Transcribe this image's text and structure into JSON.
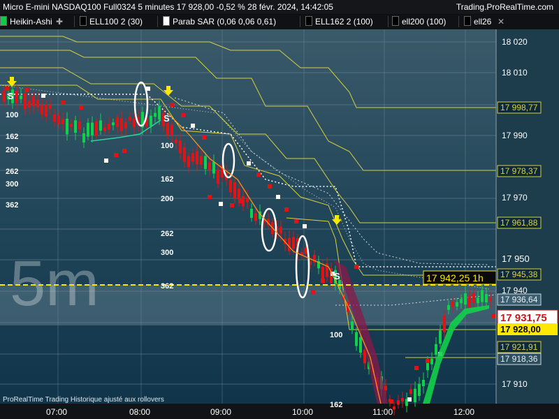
{
  "window": {
    "title": "Micro E-mini NASDAQ100 Full0324 5 minutes 17 928,00 -0,52 % 28 févr. 2024, 14:42:05",
    "brand": "Trading.ProRealTime.com"
  },
  "toolbar": {
    "items": [
      {
        "label": "Heikin-Ashi",
        "swatch": "#12c94a",
        "extra": "✚"
      },
      {
        "label": "ELL100 2 (30)",
        "swatch": "#000000"
      },
      {
        "label": "Parab SAR (0,06 0,06 0,61)",
        "swatch": "#ffffff"
      },
      {
        "label": "ELL162 2 (100)",
        "swatch": "#000000"
      },
      {
        "label": "ell200 (100)",
        "swatch": "#000000"
      },
      {
        "label": "ell26",
        "swatch": "#000000"
      }
    ],
    "close_label": "✕"
  },
  "colors": {
    "up": "#12d04a",
    "down": "#e01414",
    "sar": "#ffffff",
    "level": "#d8d040",
    "price_line": "#ffe800",
    "last_price": "#c81818",
    "grid": "#6f8797"
  },
  "watermark": "5m",
  "footer": "ProRealTime Trading  Historique ajusté aux rollovers",
  "price_axis": {
    "ticks": [
      "18 020",
      "18 010",
      "17 990",
      "17 970",
      "17 950",
      "17 940",
      "17 910"
    ],
    "tags": [
      "17 998,77",
      "17 978,37",
      "17 961,88",
      "17 945,38",
      "17 936,64",
      "17 921,91",
      "17 918,36"
    ],
    "last_price": "17 931,75",
    "current": "17 928,00"
  },
  "cursor_label": "17 942,25 1h",
  "time_axis": [
    "07:00",
    "08:00",
    "09:00",
    "10:00",
    "11:00",
    "12:00"
  ],
  "chart_labels": [
    {
      "text": "100"
    },
    {
      "text": "162"
    },
    {
      "text": "200"
    },
    {
      "text": "262"
    },
    {
      "text": "300"
    },
    {
      "text": "362"
    },
    {
      "text": "100"
    },
    {
      "text": "162"
    },
    {
      "text": "200"
    },
    {
      "text": "262"
    },
    {
      "text": "300"
    },
    {
      "text": "362"
    },
    {
      "text": "100"
    },
    {
      "text": "162"
    }
  ],
  "signals": [
    "S",
    "S",
    "S"
  ]
}
